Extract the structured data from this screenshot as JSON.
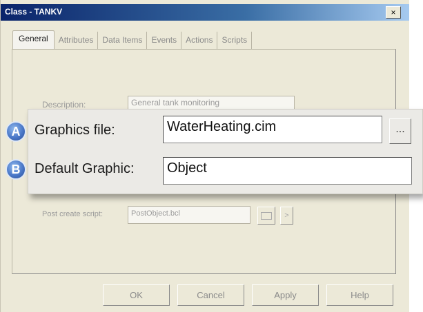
{
  "window": {
    "title": "Class - TANKV",
    "close_label": "×"
  },
  "tabs": [
    {
      "label": "General",
      "active": true
    },
    {
      "label": "Attributes"
    },
    {
      "label": "Data Items"
    },
    {
      "label": "Events"
    },
    {
      "label": "Actions"
    },
    {
      "label": "Scripts"
    }
  ],
  "general": {
    "description_label": "Description:",
    "description_value": "General tank monitoring",
    "post_create_label": "Post create script:",
    "post_create_value": "PostObject.bcl",
    "post_create_arrow": ">"
  },
  "callout": {
    "badge_a": "A",
    "badge_b": "B",
    "graphics_file_label": "Graphics file:",
    "graphics_file_value": "WaterHeating.cim",
    "browse_label": "...",
    "default_graphic_label": "Default Graphic:",
    "default_graphic_value": "Object"
  },
  "footer": {
    "ok": "OK",
    "cancel": "Cancel",
    "apply": "Apply",
    "help": "Help"
  },
  "colors": {
    "title_bar": "#0a246a",
    "badge": "#4a78c8",
    "dialog_bg": "#ece9d8"
  }
}
